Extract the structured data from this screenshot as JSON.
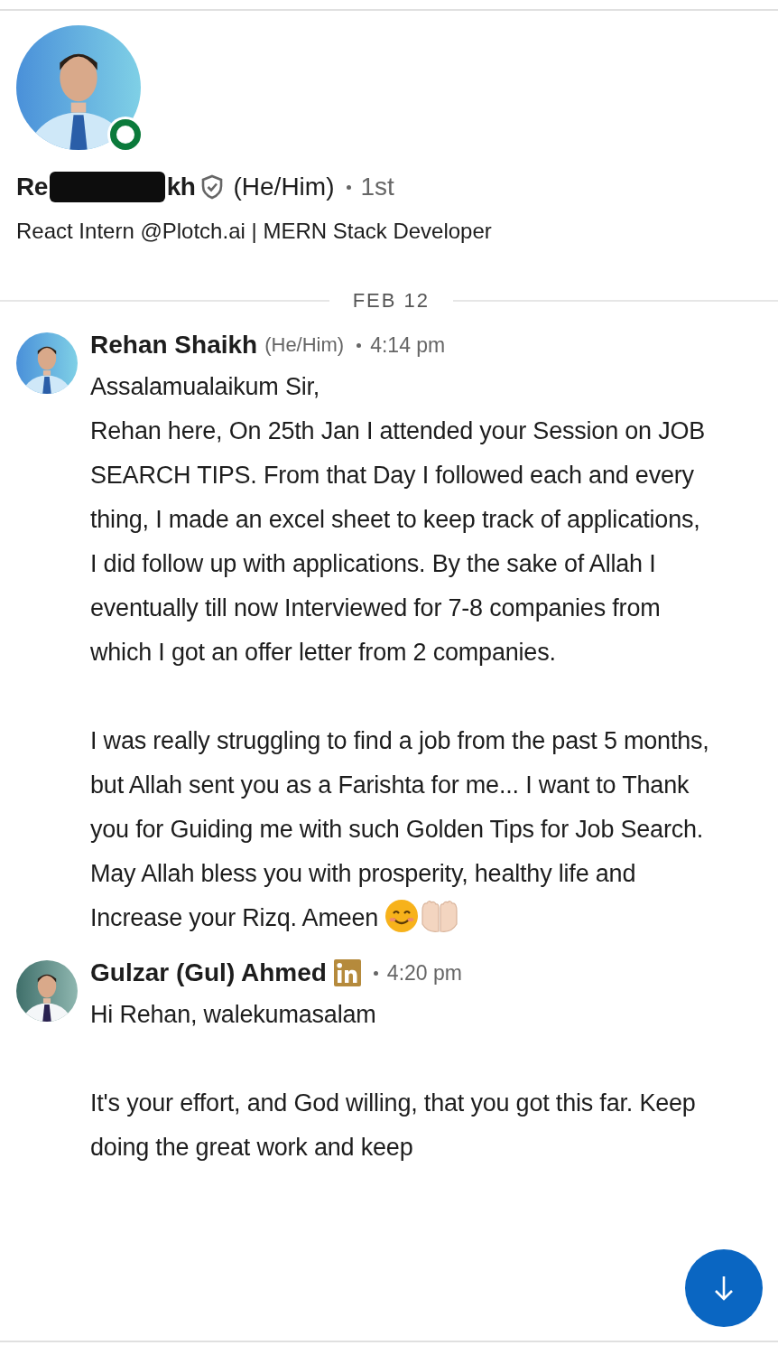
{
  "profile": {
    "name_start": "Re",
    "name_end": "kh",
    "name_redacted": true,
    "verified": true,
    "online": true,
    "pronouns": "(He/Him)",
    "degree": "1st",
    "headline": "React Intern @Plotch.ai | MERN Stack Developer"
  },
  "date_divider": "FEB 12",
  "messages": [
    {
      "sender": "Rehan Shaikh",
      "pronouns": "(He/Him)",
      "linkedin_badge": false,
      "time": "4:14 pm",
      "paragraphs": [
        "Assalamualaikum Sir,\nRehan here, On 25th Jan I attended your Session on JOB SEARCH TIPS. From that Day I followed each and every thing, I made an excel sheet to keep track of applications, I did follow up with applications. By the sake of Allah I eventually till now Interviewed for 7-8 companies from which I got an offer letter from 2 companies.",
        "I was really struggling to find a job from the past 5 months, but Allah sent you as a Farishta for me... I want to Thank you for Guiding me with such Golden Tips for Job Search. May Allah bless you with prosperity, healthy life and Increase your Rizq. Ameen"
      ],
      "emoji": true
    },
    {
      "sender": "Gulzar (Gul) Ahmed",
      "linkedin_badge": true,
      "time": "4:20 pm",
      "paragraphs": [
        "Hi Rehan, walekumasalam",
        "It's your effort, and God willing, that you got this far. Keep doing the great work and keep"
      ],
      "emoji": false
    }
  ]
}
